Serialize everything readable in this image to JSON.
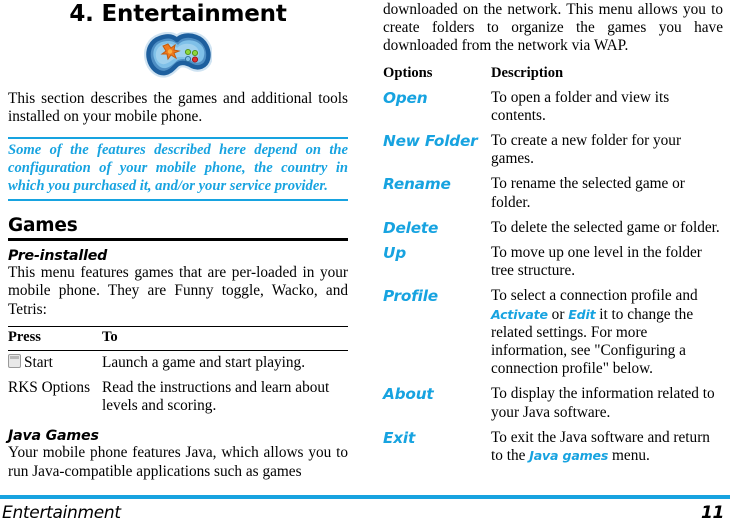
{
  "chapter": {
    "title": "4. Entertainment",
    "icon": "gamepad-icon"
  },
  "left_column": {
    "intro": "This section describes the games and additional tools installed on your mobile phone.",
    "note": "Some of the features described here depend on the configuration of your mobile phone, the country in which you purchased it, and/or your service provider.",
    "games_heading": "Games",
    "pre_installed_heading": "Pre-installed",
    "pre_installed_body": "This menu features games that are per-loaded in your mobile phone. They are Funny toggle, Wacko, and Tetris:",
    "press_table": {
      "headers": [
        "Press",
        "To"
      ],
      "rows": [
        {
          "key_icon": "softkey-icon",
          "press": "Start",
          "to": "Launch a game and start playing."
        },
        {
          "key_icon": "",
          "press": "RKS Options",
          "to": "Read the instructions and learn about levels and scoring."
        }
      ]
    },
    "java_games_heading": "Java Games",
    "java_games_body": "Your mobile phone features Java, which allows you to run Java-compatible applications such as games"
  },
  "right_column": {
    "continued_body": "downloaded on the network. This menu allows you to create folders to organize the games you have downloaded from the network via WAP.",
    "options_table": {
      "headers": [
        "Options",
        "Description"
      ],
      "rows": [
        {
          "option": "Open",
          "description": "To open a folder and view its contents."
        },
        {
          "option": "New Folder",
          "description": "To create a new folder for your games."
        },
        {
          "option": "Rename",
          "description": "To rename the selected game or folder."
        },
        {
          "option": "Delete",
          "description": "To delete the selected game or folder."
        },
        {
          "option": "Up",
          "description": "To move up one level in the folder tree structure."
        },
        {
          "option": "Profile",
          "description_part1": "To select a connection profile and ",
          "inline1": "Activate",
          "description_part2": " or ",
          "inline2": "Edit",
          "description_part3": " it to change the related settings. For more information, see \"Configuring a connection profile\" below."
        },
        {
          "option": "About",
          "description": "To display the information related to your Java software."
        },
        {
          "option": "Exit",
          "description_part1": "To exit the Java software and return to the ",
          "inline1": "Java games",
          "description_part2": " menu."
        }
      ]
    }
  },
  "footer": {
    "left": "Entertainment",
    "page_number": "11"
  },
  "colors": {
    "accent_blue": "#17a3e0",
    "text_black": "#000000",
    "page_background": "#ffffff"
  }
}
